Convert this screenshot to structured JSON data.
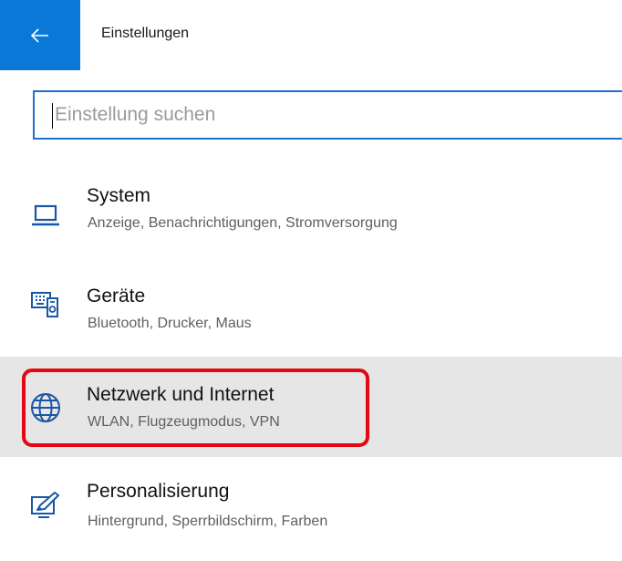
{
  "window": {
    "title": "Einstellungen"
  },
  "search": {
    "placeholder": "Einstellung suchen"
  },
  "categories": [
    {
      "name": "System",
      "description": "Anzeige, Benachrichtigungen, Stromversorgung",
      "icon": "laptop-icon"
    },
    {
      "name": "Geräte",
      "description": "Bluetooth, Drucker, Maus",
      "icon": "devices-icon"
    },
    {
      "name": "Netzwerk und Internet",
      "description": "WLAN, Flugzeugmodus, VPN",
      "icon": "globe-icon",
      "selected": true
    },
    {
      "name": "Personalisierung",
      "description": "Hintergrund, Sperrbildschirm, Farben",
      "icon": "personalization-icon"
    }
  ],
  "colors": {
    "accent": "#0a78d7",
    "highlight": "#e30613",
    "selected_bg": "#e6e6e6"
  }
}
